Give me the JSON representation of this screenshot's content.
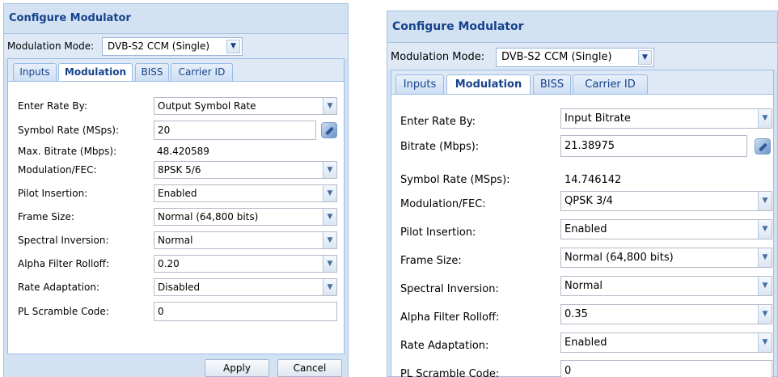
{
  "dialogs": [
    {
      "title": "Configure Modulator",
      "mode_label": "Modulation Mode:",
      "mode_value": "DVB-S2 CCM (Single)",
      "tabs": [
        "Inputs",
        "Modulation",
        "BISS",
        "Carrier ID"
      ],
      "active_tab": "Modulation",
      "fields": [
        {
          "label": "Enter Rate By:",
          "value": "Output Symbol Rate",
          "kind": "select"
        },
        {
          "label": "Symbol Rate (MSps):",
          "value": "20",
          "kind": "input-calc"
        },
        {
          "label": "Max. Bitrate (Mbps):",
          "value": "48.420589",
          "kind": "text"
        },
        {
          "label": "Modulation/FEC:",
          "value": "8PSK 5/6",
          "kind": "select"
        },
        {
          "label": "Pilot Insertion:",
          "value": "Enabled",
          "kind": "select"
        },
        {
          "label": "Frame Size:",
          "value": "Normal (64,800 bits)",
          "kind": "select"
        },
        {
          "label": "Spectral Inversion:",
          "value": "Normal",
          "kind": "select"
        },
        {
          "label": "Alpha Filter Rolloff:",
          "value": "0.20",
          "kind": "select"
        },
        {
          "label": "Rate Adaptation:",
          "value": "Disabled",
          "kind": "select"
        },
        {
          "label": "PL Scramble Code:",
          "value": "0",
          "kind": "input"
        }
      ],
      "buttons": {
        "apply": "Apply",
        "cancel": "Cancel"
      }
    },
    {
      "title": "Configure Modulator",
      "mode_label": "Modulation Mode:",
      "mode_value": "DVB-S2 CCM (Single)",
      "tabs": [
        "Inputs",
        "Modulation",
        "BISS",
        "Carrier ID"
      ],
      "active_tab": "Modulation",
      "fields": [
        {
          "label": "Enter Rate By:",
          "value": "Input Bitrate",
          "kind": "select"
        },
        {
          "label": "Bitrate (Mbps):",
          "value": "21.38975",
          "kind": "input-calc"
        },
        {
          "label": "Symbol Rate (MSps):",
          "value": "14.746142",
          "kind": "text"
        },
        {
          "label": "Modulation/FEC:",
          "value": "QPSK 3/4",
          "kind": "select"
        },
        {
          "label": "Pilot Insertion:",
          "value": "Enabled",
          "kind": "select"
        },
        {
          "label": "Frame Size:",
          "value": "Normal (64,800 bits)",
          "kind": "select"
        },
        {
          "label": "Spectral Inversion:",
          "value": "Normal",
          "kind": "select"
        },
        {
          "label": "Alpha Filter Rolloff:",
          "value": "0.35",
          "kind": "select"
        },
        {
          "label": "Rate Adaptation:",
          "value": "Enabled",
          "kind": "select"
        },
        {
          "label": "PL Scramble Code:",
          "value": "0",
          "kind": "input"
        }
      ]
    }
  ],
  "icons": {
    "dropdown": "chevron-down-icon",
    "calculator": "calculate-icon"
  },
  "colors": {
    "title_text": "#15428b",
    "panel_bg": "#d3e2f3",
    "tab_border": "#99bbe8"
  }
}
